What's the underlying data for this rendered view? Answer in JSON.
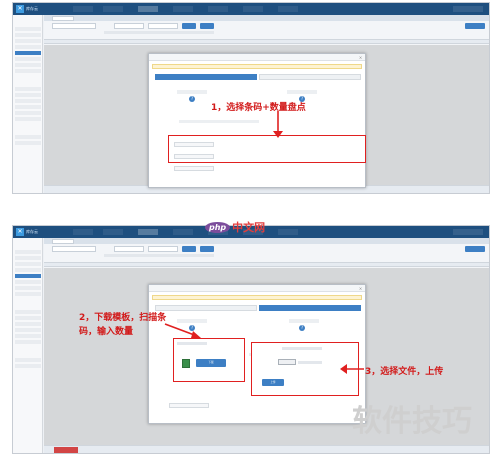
{
  "nav": {
    "logo": "库存云",
    "items": [
      "",
      "",
      "",
      "",
      "",
      "",
      ""
    ]
  },
  "annotations": {
    "step1": "1，选择条码+数量盘点",
    "step2_line1": "2，下载模板，扫描条",
    "step2_line2": "码，输入数量",
    "step3": "3，选择文件，上传"
  },
  "watermark": {
    "php_logo": "php",
    "php_text": "中文网",
    "corner": "软件技巧"
  },
  "modal1": {
    "tab_left": "",
    "tab_right": ""
  },
  "modal2": {
    "upload_button": "上传",
    "download_button": "下载"
  },
  "colors": {
    "nav": "#1e4f7f",
    "accent": "#3d7fc4",
    "annotation": "#e02020"
  }
}
